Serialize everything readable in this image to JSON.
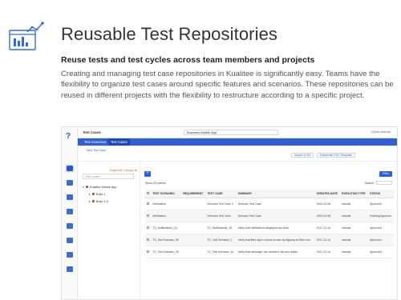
{
  "header": {
    "title": "Reusable Test Repositories",
    "subtitle": "Reuse tests and test cycles across team members and projects",
    "body": "Creating and managing test case repositories in Kualitee is significantly easy. Teams have the flexibility to organize test cases around specific features and scenarios. These repositories can be reused in different projects with the flexibility to restructure according to a specific project.",
    "icon": "repository-chart-icon",
    "accent": "#2f5fd3"
  },
  "app": {
    "breadcrumb": "Test Cases",
    "project_select": "Business Mobile App",
    "quick_actions": "Quick actions",
    "tabs": [
      "Test Scenarios",
      "Test Cases"
    ],
    "new_test_case": "New Test Case",
    "import": "Import XLSX",
    "download": "Download CSV Template",
    "filter_placeholder": "Filter nodes",
    "expand_link": "Expand all | Collapse all",
    "tree": {
      "root": "Kualitee Mobile App",
      "children": [
        "Build 1",
        "Build 1.6"
      ]
    },
    "add": "+",
    "show_entries": "Show 25 entries",
    "search_label": "Search:",
    "filter_button": "Filter",
    "table": {
      "columns": [
        "TEST SCENARIO",
        "REQUIREMENT",
        "TEST CASE",
        "SUMMARY",
        "CREATED DATE",
        "EXECUTION TYPE",
        "STATUS"
      ],
      "rows": [
        {
          "scenario": "Verification",
          "requirement": "",
          "test_case": "Demoxtz Test Case 3",
          "summary": "Demoxtz Test Case",
          "date": "2024-02-08",
          "type": "manual",
          "status": "Approved"
        },
        {
          "scenario": "Verification",
          "requirement": "",
          "test_case": "Demoxtz Test Case",
          "summary": "Demoxtz Test Case",
          "date": "2024-02-08",
          "type": "manual",
          "status": "Pending Approval"
        },
        {
          "scenario": "TS_Notifications_14",
          "requirement": "",
          "test_case": "TC_Notifications_18",
          "summary": "Verify that notifications displayed are clear",
          "date": "2017-12-14",
          "type": "manual",
          "status": "Approved"
        },
        {
          "scenario": "TS_Test Scenario_06",
          "requirement": "",
          "test_case": "TC_Test Scenario_0",
          "summary": "Verify that filter app is shown to user by tapping on filter icon",
          "date": "2017-12-14",
          "type": "manual",
          "status": "Approved"
        },
        {
          "scenario": "TS_Test Scenario_09",
          "requirement": "",
          "test_case": "TC_Test Scenario_14",
          "summary": "Verify that message i are viewed in list and visible",
          "date": "2017-12-14",
          "type": "manual",
          "status": "Approved"
        }
      ]
    }
  }
}
